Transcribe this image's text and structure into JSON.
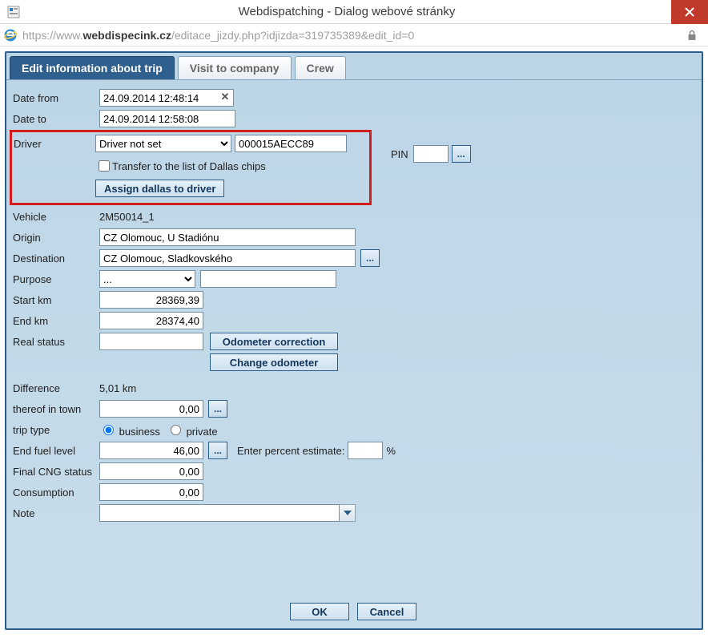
{
  "window": {
    "title": "Webdispatching - Dialog webové stránky",
    "close_label": "×"
  },
  "address": {
    "protocol": "https://www.",
    "host": "webdispecink.cz",
    "path": "/editace_jizdy.php?idjizda=319735389&edit_id=0"
  },
  "tabs": [
    {
      "id": "edit",
      "label": "Edit information about trip",
      "active": true
    },
    {
      "id": "visit",
      "label": "Visit to company",
      "active": false
    },
    {
      "id": "crew",
      "label": "Crew",
      "active": false
    }
  ],
  "form": {
    "date_from_label": "Date from",
    "date_from_value": "24.09.2014 12:48:14",
    "date_to_label": "Date to",
    "date_to_value": "24.09.2014 12:58:08",
    "driver_label": "Driver",
    "driver_select_value": "Driver not set",
    "driver_code_value": "000015AECC89",
    "pin_label": "PIN",
    "pin_value": "",
    "transfer_chk_label": "Transfer to the list of Dallas chips",
    "assign_btn_label": "Assign dallas to driver",
    "vehicle_label": "Vehicle",
    "vehicle_value": "2M50014_1",
    "origin_label": "Origin",
    "origin_value": "CZ Olomouc, U Stadiónu",
    "destination_label": "Destination",
    "destination_value": "CZ Olomouc, Sladkovského",
    "purpose_label": "Purpose",
    "purpose_select_value": "...",
    "purpose_free_value": "",
    "start_km_label": "Start km",
    "start_km_value": "28369,39",
    "end_km_label": "End km",
    "end_km_value": "28374,40",
    "real_status_label": "Real status",
    "real_status_value": "",
    "odo_corr_btn": "Odometer correction",
    "change_odo_btn": "Change odometer",
    "difference_label": "Difference",
    "difference_value": "5,01 km",
    "thereof_label": "thereof in town",
    "thereof_value": "0,00",
    "trip_type_label": "trip type",
    "trip_type_business": "business",
    "trip_type_private": "private",
    "trip_type_selected": "business",
    "end_fuel_label": "End fuel level",
    "end_fuel_value": "46,00",
    "percent_label": "Enter percent estimate:",
    "percent_value": "",
    "percent_suffix": "%",
    "cng_label": "Final CNG status",
    "cng_value": "0,00",
    "consumption_label": "Consumption",
    "consumption_value": "0,00",
    "note_label": "Note",
    "note_value": ""
  },
  "buttons": {
    "ok": "OK",
    "cancel": "Cancel",
    "dots": "..."
  }
}
